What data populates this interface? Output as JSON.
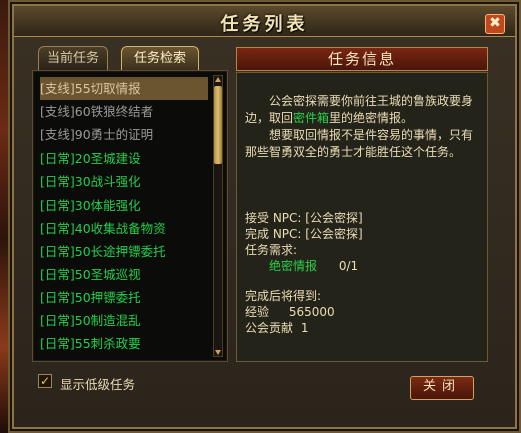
{
  "window": {
    "title": "任务列表",
    "close_icon_glyph": "✖"
  },
  "tabs": [
    {
      "label": "当前任务",
      "active": false
    },
    {
      "label": "任务检索",
      "active": true
    }
  ],
  "quest_list": [
    {
      "label": "[支线]55切取情报",
      "color": "gray",
      "selected": true
    },
    {
      "label": "[支线]60铁狼终结者",
      "color": "gray"
    },
    {
      "label": "[支线]90勇士的证明",
      "color": "gray"
    },
    {
      "label": "[日常]20圣城建设",
      "color": "green"
    },
    {
      "label": "[日常]30战斗强化",
      "color": "green"
    },
    {
      "label": "[日常]30体能强化",
      "color": "green"
    },
    {
      "label": "[日常]40收集战备物资",
      "color": "green"
    },
    {
      "label": "[日常]50长途押镖委托",
      "color": "green"
    },
    {
      "label": "[日常]50圣城巡视",
      "color": "green"
    },
    {
      "label": "[日常]50押镖委托",
      "color": "green"
    },
    {
      "label": "[日常]50制造混乱",
      "color": "green"
    },
    {
      "label": "[日常]55刺杀政要",
      "color": "green"
    }
  ],
  "options": {
    "show_low_level_label": "显示低级任务",
    "show_low_level_checked": true
  },
  "info": {
    "header": "任务信息",
    "para1_a": "公会密探需要你前往王城的鲁族政要身边，取回",
    "para1_hl": "密件箱",
    "para1_b": "里的绝密情报。",
    "para2": "想要取回情报不是件容易的事情，只有那些智勇双全的勇士才能胜任这个任务。",
    "accept_npc": "接受 NPC: [公会密探]",
    "complete_npc": "完成 NPC: [公会密探]",
    "requirement_label": "任务需求:",
    "requirement_item": "绝密情报",
    "requirement_count": "0/1",
    "reward_label": "完成后将得到:",
    "exp_label": "经验",
    "exp_value": "565000",
    "guild_label": "公会贡献",
    "guild_value": "1"
  },
  "buttons": {
    "close_label": "关闭"
  },
  "colors": {
    "green_text": "#22d04a",
    "gray_text": "#9a9a9a"
  }
}
